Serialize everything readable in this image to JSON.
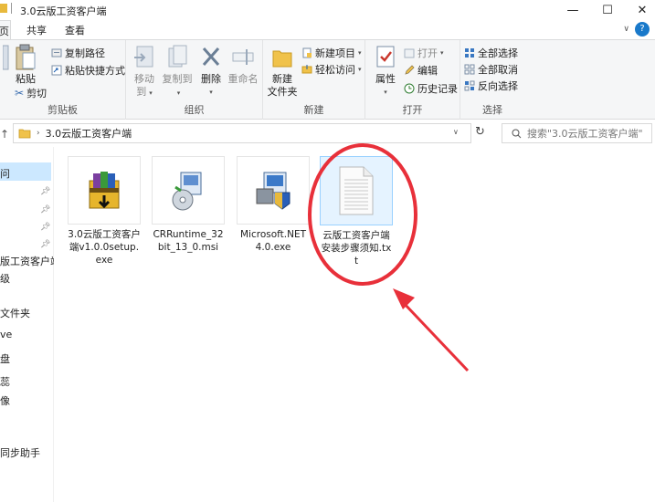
{
  "window": {
    "title": "3.0云版工资客户端",
    "minimize": "—",
    "maximize": "☐",
    "close": "✕"
  },
  "tabs": [
    {
      "label": "页"
    },
    {
      "label": "共享"
    },
    {
      "label": "查看"
    }
  ],
  "ribbon": {
    "clipboard": {
      "label": "剪贴板",
      "paste": "粘贴",
      "copy_path": "复制路径",
      "paste_shortcut": "粘贴快捷方式",
      "cut": "剪切"
    },
    "organize": {
      "label": "组织",
      "move_to": "移动到",
      "copy_to": "复制到",
      "delete": "删除",
      "rename": "重命名"
    },
    "new": {
      "label": "新建",
      "new_folder_line1": "新建",
      "new_folder_line2": "文件夹",
      "new_item": "新建项目",
      "easy_access": "轻松访问"
    },
    "open": {
      "label": "打开",
      "properties": "属性",
      "open": "打开",
      "edit": "编辑",
      "history": "历史记录"
    },
    "select": {
      "label": "选择",
      "select_all": "全部选择",
      "select_none": "全部取消",
      "invert": "反向选择"
    }
  },
  "address": {
    "path": "3.0云版工资客户端",
    "search_placeholder": "搜索\"3.0云版工资客户端\""
  },
  "nav": [
    {
      "label": "问"
    },
    {
      "label": "版工资客户端"
    },
    {
      "label": "级"
    },
    {
      "label": "文件夹"
    },
    {
      "label": "ve"
    },
    {
      "label": "盘"
    },
    {
      "label": "蕊"
    },
    {
      "label": "像"
    },
    {
      "label": "同步助手"
    }
  ],
  "files": [
    {
      "name": "3.0云版工资客户端v1.0.0setup.exe",
      "icon": "winrar-installer-icon"
    },
    {
      "name": "CRRuntime_32bit_13_0.msi",
      "icon": "msi-installer-icon"
    },
    {
      "name": "Microsoft.NET4.0.exe",
      "icon": "setup-exe-icon"
    },
    {
      "name": "云版工资客户端安装步骤须知.txt",
      "icon": "text-file-icon"
    }
  ],
  "colors": {
    "annotation": "#e8303a",
    "selection": "#cce8ff",
    "accent": "#1979ca"
  }
}
